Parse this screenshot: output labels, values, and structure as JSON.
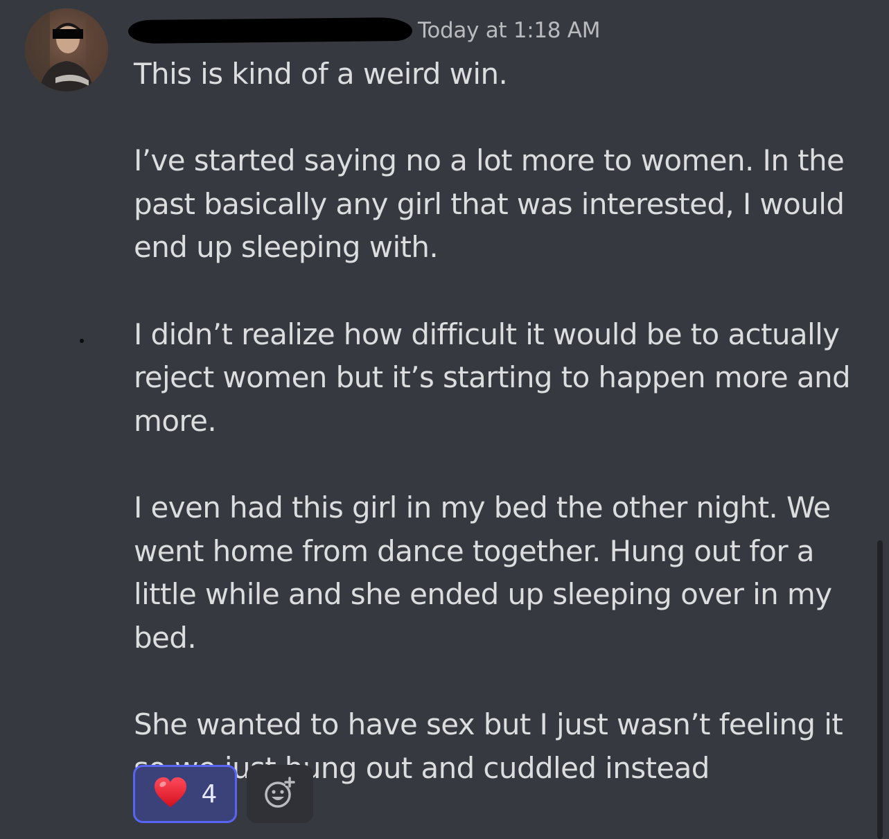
{
  "message": {
    "username": "",
    "timestamp": "Today at 1:18 AM",
    "paragraphs": [
      "This is kind of a weird win.",
      "I’ve started saying no a lot more to women. In the past basically any girl that was interested, I would end up sleeping with.",
      "I didn’t realize how difficult it would be to actually reject women but it’s starting to happen more and more.",
      "I even had this girl in my bed the other night. We went home from dance together. Hung out for a little while and she ended up sleeping over in my bed.",
      "She wanted to have sex but I just wasn’t feeling it so we just hung out and cuddled instead"
    ]
  },
  "reactions": [
    {
      "emoji": "heart-icon",
      "count": "4",
      "active": true
    }
  ],
  "add_reaction": {
    "icon": "add-emoji-icon"
  },
  "colors": {
    "background": "#36393f",
    "text": "#dcddde",
    "timestamp": "#b9bbbe",
    "reaction_active_bg": "#3b4279",
    "reaction_active_border": "#5865f2",
    "heart": "#e8202f"
  }
}
